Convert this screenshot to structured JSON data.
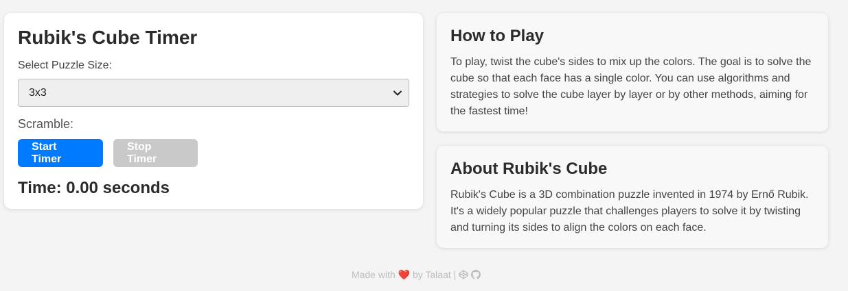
{
  "timer": {
    "title": "Rubik's Cube Timer",
    "select_label": "Select Puzzle Size:",
    "puzzle_size": "3x3",
    "scramble_label": "Scramble:",
    "start_label": "Start Timer",
    "stop_label": "Stop Timer",
    "time_text": "Time: 0.00 seconds"
  },
  "how_to_play": {
    "title": "How to Play",
    "text": "To play, twist the cube's sides to mix up the colors. The goal is to solve the cube so that each face has a single color. You can use algorithms and strategies to solve the cube layer by layer or by other methods, aiming for the fastest time!"
  },
  "about": {
    "title": "About Rubik's Cube",
    "text": "Rubik's Cube is a 3D combination puzzle invented in 1974 by Ernő Rubik. It's a widely popular puzzle that challenges players to solve it by twisting and turning its sides to align the colors on each face."
  },
  "footer": {
    "made_with": "Made with",
    "heart": "❤️",
    "by": "by Talaat",
    "separator": "|",
    "icons": [
      "codepen-icon",
      "github-icon"
    ]
  },
  "colors": {
    "primary": "#007bff",
    "disabled": "#c9c9c9",
    "background": "#f4f4f4"
  }
}
